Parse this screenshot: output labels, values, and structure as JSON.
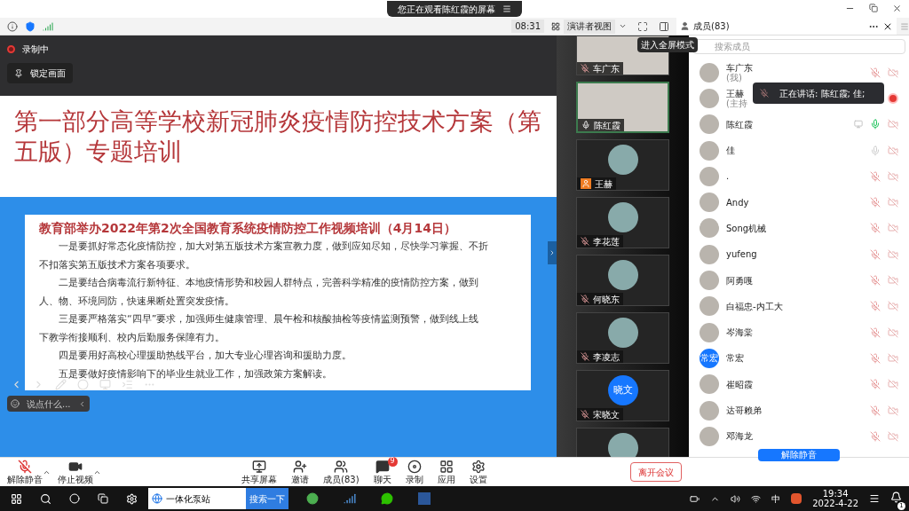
{
  "window": {
    "banner": "您正在观看陈红霞的屏幕"
  },
  "toolbar": {
    "timer": "08:31",
    "view_mode": "演讲者视图",
    "tooltip": "进入全屏模式"
  },
  "share": {
    "recording": "录制中",
    "lock_button": "锁定画面",
    "chat_placeholder": "说点什么...",
    "slide": {
      "title": "第一部分高等学校新冠肺炎疫情防控技术方案（第五版）专题培训",
      "heading": "教育部举办2022年第2次全国教育系统疫情防控工作视频培训（4月14日）",
      "paragraphs": [
        "一是要抓好常态化疫情防控，加大对第五版技术方案宣教力度，做到应知尽知，尽快学习掌握、不折不扣落实第五版技术方案各项要求。",
        "二是要结合病毒流行新特征、本地疫情形势和校园人群特点，完善科学精准的疫情防控方案，做到人、物、环境同防，快速果断处置突发疫情。",
        "三是要严格落实“四早”要求，加强师生健康管理、晨午检和核酸抽检等疫情监测预警，做到线上线下教学衔接顺利、校内后勤服务保障有力。",
        "四是要用好高校心理援助热线平台，加大专业心理咨询和援助力度。",
        "五是要做好疫情影响下的毕业生就业工作，加强政策方案解读。"
      ]
    }
  },
  "video_tiles": [
    {
      "name": "车广东",
      "kind": "photo",
      "muted": true,
      "selected": false
    },
    {
      "name": "陈红霞",
      "kind": "photo",
      "muted": false,
      "selected": true
    },
    {
      "name": "王赫",
      "kind": "avatar",
      "host": true,
      "selected": false
    },
    {
      "name": "李花莲",
      "kind": "avatar",
      "muted": true,
      "selected": false
    },
    {
      "name": "何晓东",
      "kind": "avatar",
      "muted": true,
      "selected": false
    },
    {
      "name": "李凌志",
      "kind": "avatar",
      "muted": true,
      "selected": false
    },
    {
      "name": "宋晓文",
      "kind": "text",
      "avatar_text": "晓文",
      "muted": true,
      "selected": false
    },
    {
      "kind": "avatar",
      "selected": false
    }
  ],
  "members": {
    "title": "成员(83)",
    "search_placeholder": "搜索成员",
    "speaking_tooltip": "正在讲话: 陈红霞; 佳;",
    "unmute_button": "解除静音",
    "list": [
      {
        "name": "车广东",
        "note": "(我)",
        "muted": true
      },
      {
        "name": "王赫",
        "note": "(主持",
        "recording": true
      },
      {
        "name": "陈红霞",
        "muted": false,
        "speaking": true,
        "sharing": true
      },
      {
        "name": "佳",
        "muted": false,
        "speaking": false
      },
      {
        "name": ".",
        "muted": true
      },
      {
        "name": "Andy",
        "muted": true
      },
      {
        "name": "Song机械",
        "muted": true
      },
      {
        "name": "yufeng",
        "muted": true
      },
      {
        "name": "阿勇嘎",
        "muted": true
      },
      {
        "name": "白福忠-内工大",
        "muted": true
      },
      {
        "name": "岑海棠",
        "muted": true
      },
      {
        "name": "常宏",
        "avatar_text": "常宏",
        "muted": true
      },
      {
        "name": "崔昭霞",
        "muted": true
      },
      {
        "name": "达哥赖弟",
        "muted": true
      },
      {
        "name": "邓海龙",
        "muted": true
      }
    ]
  },
  "bottom_bar": {
    "left": [
      {
        "label": "解除静音",
        "kind": "mic"
      },
      {
        "label": "停止视频",
        "kind": "video"
      }
    ],
    "center": [
      {
        "label": "共享屏幕",
        "kind": "share"
      },
      {
        "label": "邀请",
        "kind": "invite"
      },
      {
        "label": "成员(83)",
        "kind": "members"
      },
      {
        "label": "聊天",
        "kind": "chat",
        "badge": "9"
      },
      {
        "label": "录制",
        "kind": "record"
      },
      {
        "label": "应用",
        "kind": "apps"
      },
      {
        "label": "设置",
        "kind": "settings"
      }
    ],
    "leave": "离开会议"
  },
  "taskbar": {
    "search_value": "一体化泵站",
    "search_button": "搜索一下",
    "ime": "中",
    "time": "19:34",
    "date": "2022-4-22",
    "notifications": "1"
  }
}
